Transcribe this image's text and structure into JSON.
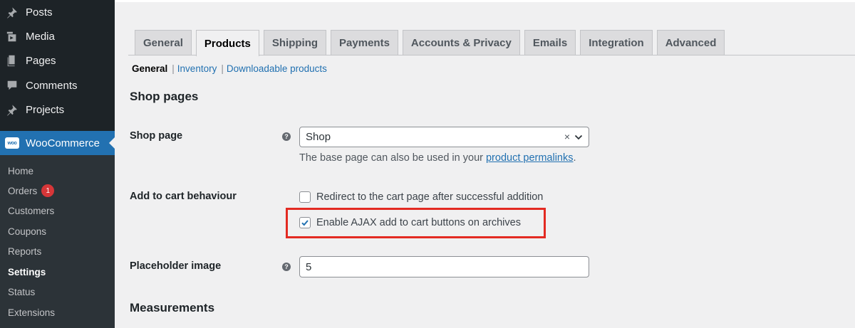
{
  "sidebar": {
    "menu": [
      {
        "label": "Posts",
        "icon": "pin-icon"
      },
      {
        "label": "Media",
        "icon": "media-icon"
      },
      {
        "label": "Pages",
        "icon": "pages-icon"
      },
      {
        "label": "Comments",
        "icon": "comment-icon"
      },
      {
        "label": "Projects",
        "icon": "pin-icon"
      }
    ],
    "woocommerce": {
      "label": "WooCommerce",
      "icon_text": "woo"
    },
    "submenu": [
      {
        "label": "Home"
      },
      {
        "label": "Orders",
        "badge": "1"
      },
      {
        "label": "Customers"
      },
      {
        "label": "Coupons"
      },
      {
        "label": "Reports"
      },
      {
        "label": "Settings"
      },
      {
        "label": "Status"
      },
      {
        "label": "Extensions"
      }
    ]
  },
  "tabs": [
    "General",
    "Products",
    "Shipping",
    "Payments",
    "Accounts & Privacy",
    "Emails",
    "Integration",
    "Advanced"
  ],
  "subnav": {
    "current": "General",
    "links": [
      "Inventory",
      "Downloadable products"
    ],
    "separator": "|"
  },
  "section_shop_pages": "Shop pages",
  "shop_page": {
    "label": "Shop page",
    "help": "?",
    "value": "Shop",
    "clear": "×",
    "desc_prefix": "The base page can also be used in your ",
    "desc_link": "product permalinks",
    "desc_suffix": "."
  },
  "add_to_cart": {
    "label": "Add to cart behaviour",
    "options": [
      {
        "label": "Redirect to the cart page after successful addition",
        "checked": false
      },
      {
        "label": "Enable AJAX add to cart buttons on archives",
        "checked": true
      }
    ]
  },
  "placeholder_image": {
    "label": "Placeholder image",
    "help": "?",
    "value": "5"
  },
  "section_measurements": "Measurements",
  "colors": {
    "accent": "#2271b1",
    "highlight": "#e32a22",
    "sidebar": "#1d2327"
  }
}
